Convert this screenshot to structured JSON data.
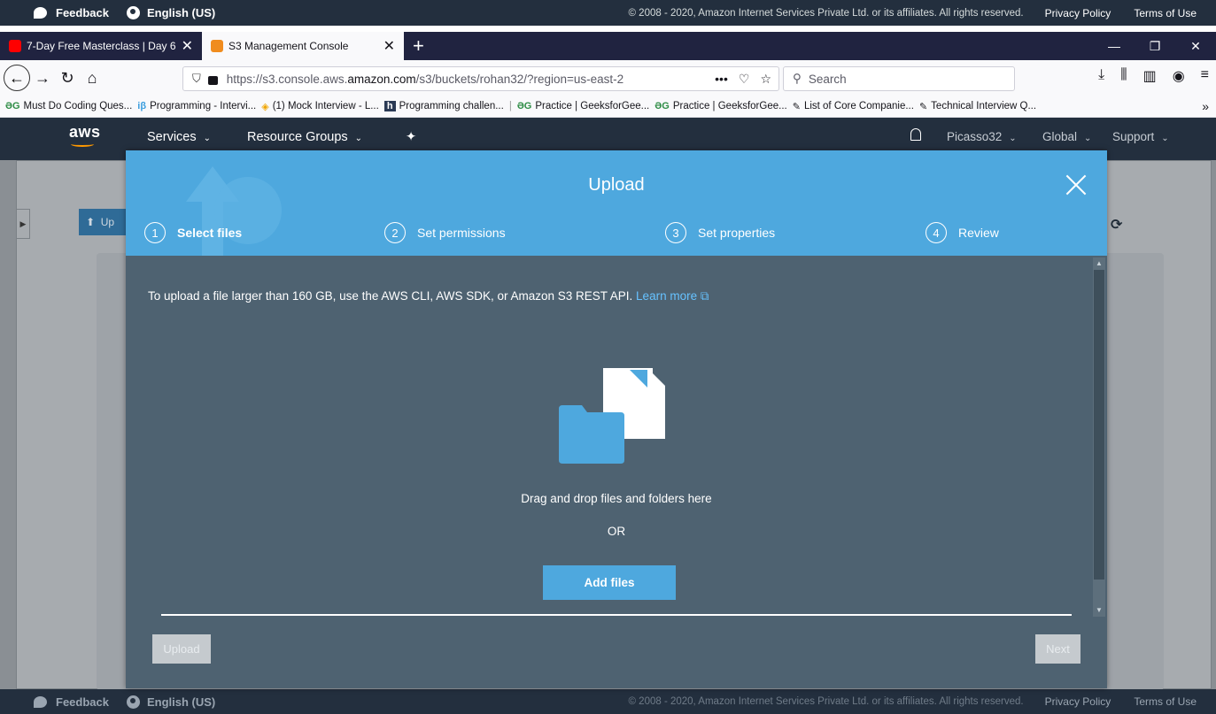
{
  "footer_strip": {
    "feedback": "Feedback",
    "language": "English (US)",
    "copyright": "© 2008 - 2020, Amazon Internet Services Private Ltd. or its affiliates. All rights reserved.",
    "privacy": "Privacy Policy",
    "terms": "Terms of Use"
  },
  "browser": {
    "tabs": [
      {
        "label": "7-Day Free Masterclass | Day 6 -",
        "close": "✕",
        "fav_color": "#ff0000"
      },
      {
        "label": "S3 Management Console",
        "close": "✕",
        "fav_color": "#f08c1e"
      }
    ],
    "new_tab": "+",
    "window_controls": [
      "—",
      "❐",
      "✕"
    ],
    "url_prefix": "https://s3.console.aws.",
    "url_domain": "amazon.com",
    "url_path": "/s3/buckets/rohan32/?region=us-east-2",
    "url_actions": [
      "•••",
      "♡",
      "☆"
    ],
    "search_placeholder": "Search",
    "bookmarks": [
      {
        "icon": "ƏG",
        "label": "Must Do Coding Ques..."
      },
      {
        "icon": "iβ",
        "label": "Programming - Intervi..."
      },
      {
        "icon": "◈",
        "label": "(1) Mock Interview - L..."
      },
      {
        "icon": "h",
        "label": "Programming challen..."
      },
      {
        "icon": "ƏG",
        "label": "Practice | GeeksforGee..."
      },
      {
        "icon": "ƏG",
        "label": "Practice | GeeksforGee..."
      },
      {
        "icon": "✎",
        "label": "List of Core Companie..."
      },
      {
        "icon": "✎",
        "label": "Technical Interview Q..."
      }
    ],
    "bookmarks_more": "»"
  },
  "aws_header": {
    "logo": "aws",
    "services": "Services",
    "resource_groups": "Resource Groups",
    "user": "Picasso32",
    "region": "Global",
    "support": "Support"
  },
  "background_page": {
    "upload_button": "Up"
  },
  "modal": {
    "title": "Upload",
    "steps": [
      {
        "num": "1",
        "label": "Select files"
      },
      {
        "num": "2",
        "label": "Set permissions"
      },
      {
        "num": "3",
        "label": "Set properties"
      },
      {
        "num": "4",
        "label": "Review"
      }
    ],
    "note": "To upload a file larger than 160 GB, use the AWS CLI, AWS SDK, or Amazon S3 REST API.",
    "learn_more": "Learn more",
    "drag_text": "Drag and drop files and folders here",
    "or_text": "OR",
    "add_files": "Add files",
    "upload_button": "Upload",
    "next_button": "Next"
  },
  "colors": {
    "aws_dark": "#232f3e",
    "modal_blue": "#4ea8de",
    "modal_body": "#4e6271",
    "link_blue": "#66c2ff"
  }
}
